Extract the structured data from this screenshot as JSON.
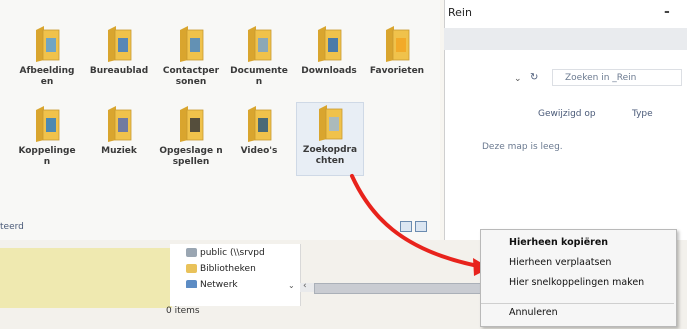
{
  "folders": [
    {
      "label": "Afbeelding en",
      "icon": "pictures-folder-icon"
    },
    {
      "label": "Bureaublad",
      "icon": "desktop-folder-icon"
    },
    {
      "label": "Contactper sonen",
      "icon": "contacts-folder-icon"
    },
    {
      "label": "Documente n",
      "icon": "documents-folder-icon"
    },
    {
      "label": "Downloads",
      "icon": "downloads-folder-icon"
    },
    {
      "label": "Favorieten",
      "icon": "favorites-folder-icon"
    },
    {
      "label": "Koppelinge n",
      "icon": "links-folder-icon"
    },
    {
      "label": "Muziek",
      "icon": "music-folder-icon"
    },
    {
      "label": "Opgeslage n spellen",
      "icon": "saved-games-folder-icon"
    },
    {
      "label": "Video's",
      "icon": "videos-folder-icon"
    },
    {
      "label": "Zoekopdra chten",
      "icon": "searches-folder-icon"
    }
  ],
  "left_status": "teerd",
  "nav_tree": {
    "items": [
      {
        "label": "public (\\\\srvpd",
        "icon": "network-drive-icon"
      },
      {
        "label": "Bibliotheken",
        "icon": "libraries-icon"
      },
      {
        "label": "Netwerk",
        "icon": "network-icon"
      }
    ]
  },
  "items_count": "0 items",
  "right_window": {
    "title": "Rein",
    "minimize": "-",
    "refresh_icon": "refresh-icon",
    "search_placeholder": "Zoeken in _Rein",
    "columns": {
      "modified": "Gewijzigd op",
      "type": "Type"
    },
    "empty_message": "Deze map is leeg."
  },
  "context_menu": {
    "items": [
      {
        "label": "Hierheen kopiëren",
        "bold": true
      },
      {
        "label": "Hierheen verplaatsen",
        "bold": false
      },
      {
        "label": "Hier snelkoppelingen maken",
        "bold": false
      },
      {
        "label": "Annuleren",
        "bold": false
      }
    ]
  },
  "colors": {
    "arrow": "#e8231c",
    "folder": "#f0c24b",
    "selection": "#e8eef5"
  }
}
